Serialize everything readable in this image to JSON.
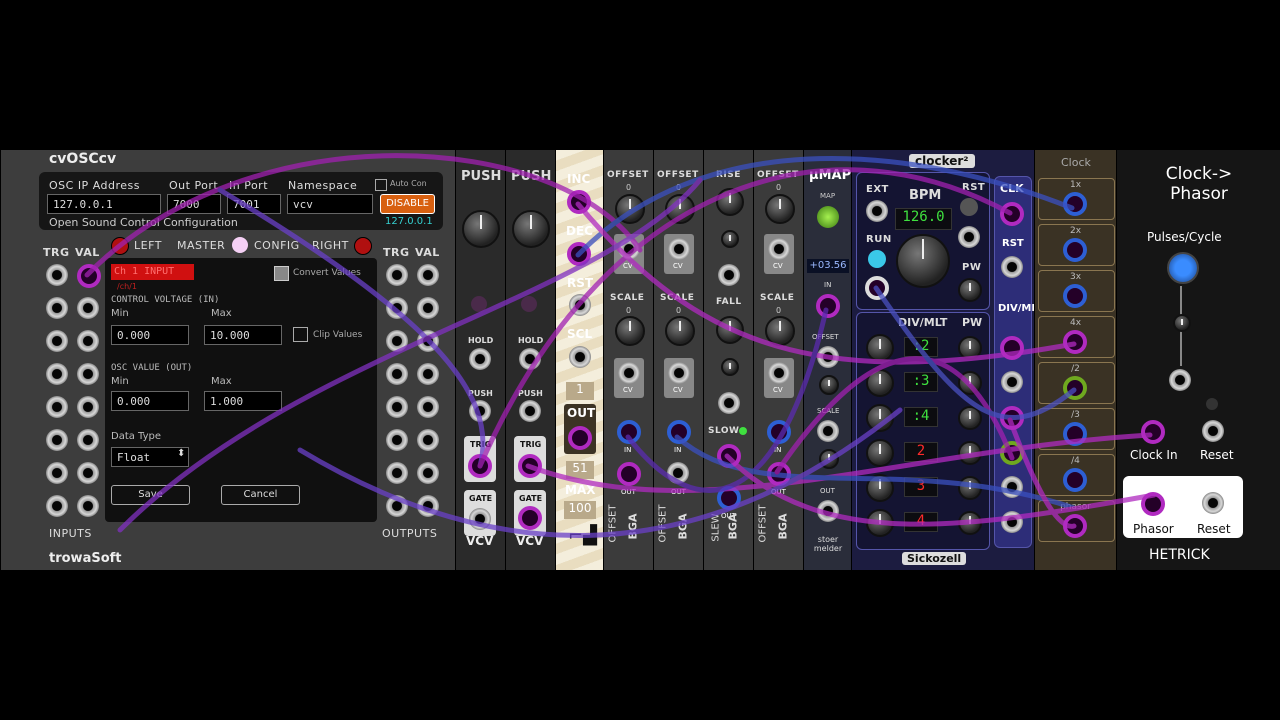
{
  "trowa": {
    "title": "cvOSCcv",
    "osc_ip_label": "OSC IP Address",
    "out_port_label": "Out Port",
    "in_port_label": "In Port",
    "namespace_label": "Namespace",
    "auto_con_label": "Auto Con",
    "ip_value": "127.0.0.1",
    "out_port_value": "7000",
    "in_port_value": "7001",
    "namespace_value": "vcv",
    "disable_label": "DISABLE",
    "connected_ip": "127.0.0.1",
    "config_caption": "Open Sound Control Configuration",
    "trg": "TRG",
    "val": "VAL",
    "left": "LEFT",
    "master": "MASTER",
    "config": "CONFIG",
    "right": "RIGHT",
    "channel_name": "Ch 1 INPUT",
    "channel_sub": "/ch/1",
    "convert_values": "Convert Values",
    "control_voltage": "CONTROL VOLTAGE (IN)",
    "min": "Min",
    "max": "Max",
    "cv_min": "0.000",
    "cv_max": "10.000",
    "clip_values": "Clip Values",
    "osc_value": "OSC VALUE (OUT)",
    "osc_min": "0.000",
    "osc_max": "1.000",
    "data_type_label": "Data Type",
    "data_type_value": "Float",
    "save": "Save",
    "cancel": "Cancel",
    "inputs": "INPUTS",
    "outputs": "OUTPUTS",
    "brand": "trowaSoft"
  },
  "push": {
    "title": "PUSH",
    "hold": "HOLD",
    "push": "PUSH",
    "trig": "TRIG",
    "gate": "GATE",
    "brand": "VCV"
  },
  "stepper": {
    "inc": "INC",
    "dec": "DEC",
    "rst": "RST",
    "scl": "SCL",
    "min_val": "1",
    "out": "OUT",
    "cur_val": "51",
    "max": "MAX",
    "max_val": "100"
  },
  "offset": {
    "offset": "OFFSET",
    "scale": "SCALE",
    "cv": "CV",
    "in": "IN",
    "out": "OUT",
    "side": "OFFSET",
    "brand": "BGA",
    "zero": "0"
  },
  "slew": {
    "rise": "RISE",
    "fall": "FALL",
    "slow": "SLOW",
    "out": "OUT",
    "side": "SLEW",
    "brand": "BGA"
  },
  "umap": {
    "title": "μMAP",
    "map": "MAP",
    "value": "+03.56",
    "in": "IN",
    "offset": "OFFSET",
    "scale": "SCALE",
    "out": "OUT",
    "brand": "stoer melder"
  },
  "clocker": {
    "title": "clocker²",
    "ext": "EXT",
    "bpm": "BPM",
    "rst": "RST",
    "bpm_value": "126.0",
    "run": "RUN",
    "pw": "PW",
    "divmlt": "DIV/MLT",
    "ratios": [
      ":2",
      ":3",
      ":4",
      "2",
      "3",
      "4"
    ],
    "ratio_colors": [
      "#3fe03f",
      "#3fe03f",
      "#3fe03f",
      "#ff2a2a",
      "#ff2a2a",
      "#ff2a2a"
    ],
    "clk": "CLK",
    "rst2": "RST",
    "divmlt2": "DIV/MLT",
    "brand": "Sickozell"
  },
  "hclock": {
    "title": "Clock",
    "labels": [
      "1x",
      "2x",
      "3x",
      "4x",
      "/2",
      "/3",
      "/4",
      "phasor"
    ]
  },
  "phasor": {
    "title": "Clock->\nPhasor",
    "pulses": "Pulses/Cycle",
    "clock_in": "Clock In",
    "reset": "Reset",
    "phasor": "Phasor",
    "reset2": "Reset",
    "brand": "HETRICK"
  }
}
